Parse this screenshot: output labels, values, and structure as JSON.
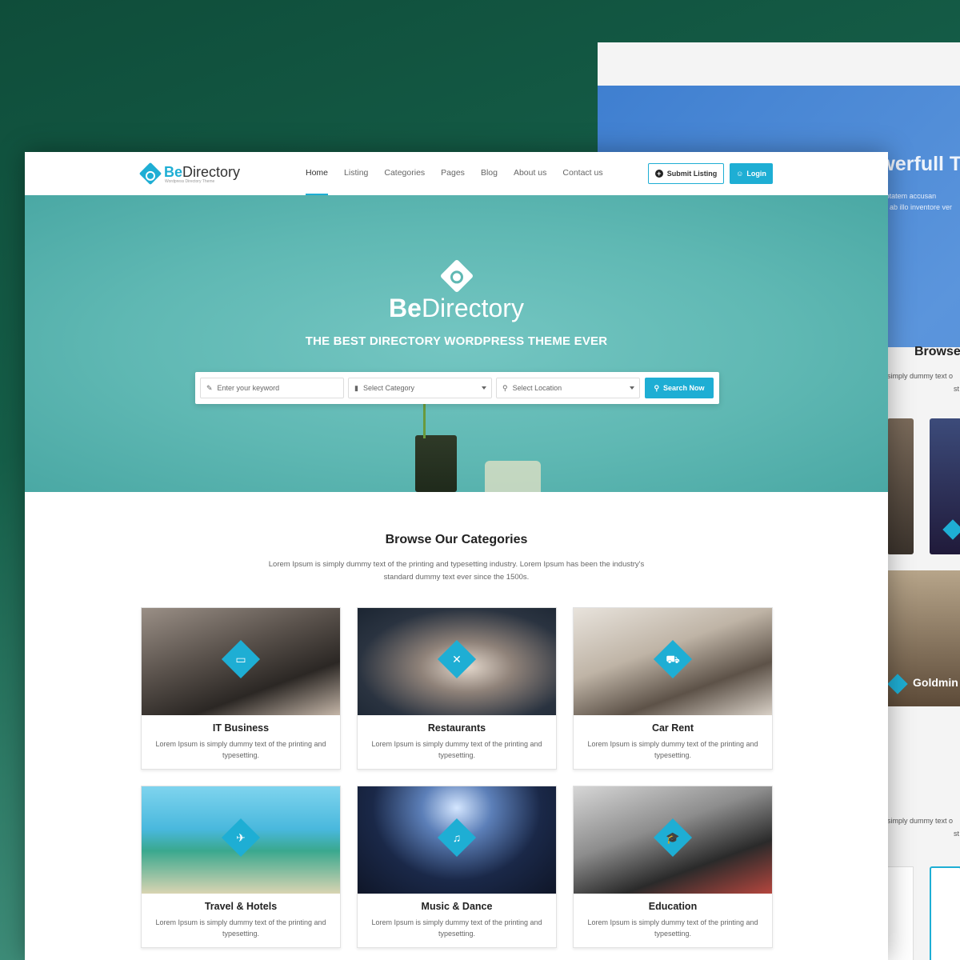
{
  "colors": {
    "accent": "#1eaed4",
    "hero_bg": "#5fb8b3",
    "bg_gradient": "#155e48"
  },
  "background_preview": {
    "hero_title": "BeDirectory is Powerfull Th",
    "hero_text_line1": "Sed ut perspiciatis unde omnis iste natus error sit voluptatem accusan",
    "hero_text_line2": "ab illo inventore ver",
    "section_title": "Browse",
    "section_sub_line1": "simply dummy text o",
    "section_sub_line2": "st",
    "tile_label": "Goldmin",
    "section2_sub_line1": "simply dummy text o",
    "section2_sub_line2": "st"
  },
  "nav": {
    "brand_be": "Be",
    "brand_rest": "Directory",
    "tagline": "Wordpress Directory Theme",
    "items": [
      {
        "label": "Home",
        "active": true
      },
      {
        "label": "Listing"
      },
      {
        "label": "Categories"
      },
      {
        "label": "Pages"
      },
      {
        "label": "Blog"
      },
      {
        "label": "About us"
      },
      {
        "label": "Contact us"
      }
    ],
    "submit_label": "Submit Listing",
    "submit_icon": "plus-circle-icon",
    "login_label": "Login",
    "login_icon": "user-icon"
  },
  "hero": {
    "brand_be": "Be",
    "brand_rest": "Directory",
    "slogan": "THE BEST DIRECTORY WORDPRESS THEME EVER"
  },
  "search": {
    "keyword_placeholder": "Enter your keyword",
    "category_placeholder": "Select Category",
    "location_placeholder": "Select Location",
    "button_label": "Search Now"
  },
  "categories": {
    "title": "Browse Our Categories",
    "subtitle": "Lorem Ipsum is simply dummy text of the printing and typesetting industry. Lorem Ipsum has been the industry's standard dummy text ever since the 1500s.",
    "items": [
      {
        "name": "IT Business",
        "icon": "monitor-icon",
        "glyph": "▭",
        "text": "Lorem Ipsum is simply dummy text of the printing and typesetting."
      },
      {
        "name": "Restaurants",
        "icon": "cutlery-icon",
        "glyph": "✕",
        "text": "Lorem Ipsum is simply dummy text of the printing and typesetting."
      },
      {
        "name": "Car Rent",
        "icon": "car-icon",
        "glyph": "⛟",
        "text": "Lorem Ipsum is simply dummy text of the printing and typesetting."
      },
      {
        "name": "Travel & Hotels",
        "icon": "airplane-icon",
        "glyph": "✈",
        "text": "Lorem Ipsum is simply dummy text of the printing and typesetting."
      },
      {
        "name": "Music & Dance",
        "icon": "music-note-icon",
        "glyph": "♫",
        "text": "Lorem Ipsum is simply dummy text of the printing and typesetting."
      },
      {
        "name": "Education",
        "icon": "graduation-cap-icon",
        "glyph": "🎓",
        "text": "Lorem Ipsum is simply dummy text of the printing and typesetting."
      }
    ]
  }
}
